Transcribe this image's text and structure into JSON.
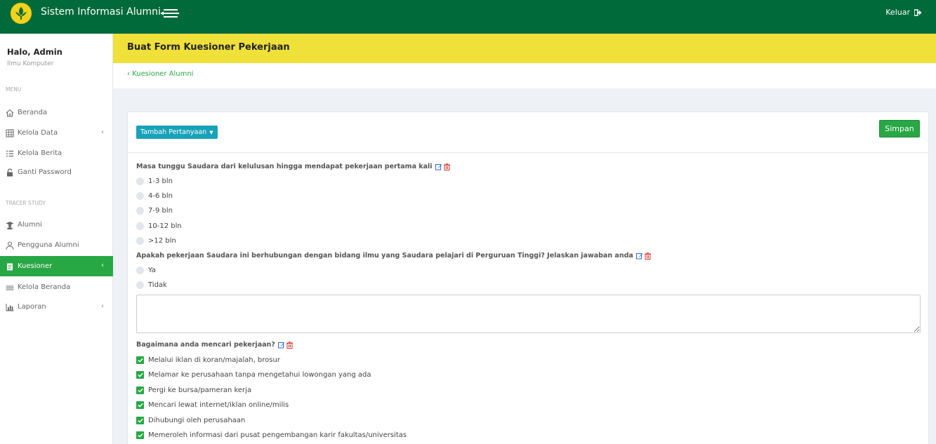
{
  "app": {
    "title": "Sistem Informasi Alumni",
    "logout_label": "Keluar"
  },
  "sidebar": {
    "greeting": "Halo, Admin",
    "department": "Ilmu Komputer",
    "menu_label": "MENU",
    "tracer_label": "TRACER STUDY",
    "items": [
      {
        "label": "Beranda",
        "icon": "home-icon"
      },
      {
        "label": "Kelola Data",
        "icon": "table-icon"
      },
      {
        "label": "Kelola Berita",
        "icon": "list-icon"
      },
      {
        "label": "Ganti Password",
        "icon": "lock-icon"
      },
      {
        "label": "Alumni",
        "icon": "graduate-icon"
      },
      {
        "label": "Pengguna Alumni",
        "icon": "user-icon"
      },
      {
        "label": "Kuesioner",
        "icon": "clipboard-icon",
        "active": true
      },
      {
        "label": "Kelola Beranda",
        "icon": "menu-lines-icon"
      },
      {
        "label": "Laporan",
        "icon": "bar-chart-icon"
      }
    ]
  },
  "page": {
    "title": "Buat Form Kuesioner Pekerjaan",
    "breadcrumb": "Kuesioner Alumni",
    "add_question_label": "Tambah Pertanyaan",
    "save_label": "Simpan"
  },
  "questions": [
    {
      "text": "Masa tunggu Saudara dari kelulusan hingga mendapat pekerjaan pertama kali",
      "type": "radio",
      "options": [
        "1-3 bln",
        "4-6 bln",
        "7-9 bln",
        "10-12 bln",
        ">12 bln"
      ]
    },
    {
      "text": "Apakah pekerjaan Saudara ini berhubungan dengan bidang ilmu yang Saudara pelajari di Perguruan Tinggi? Jelaskan jawaban anda",
      "type": "radio+textarea",
      "options": [
        "Ya",
        "Tidak"
      ]
    },
    {
      "text": "Bagaimana anda mencari pekerjaan?",
      "type": "checkbox",
      "options": [
        "Melalui iklan di koran/majalah, brosur",
        "Melamar ke perusahaan tanpa mengetahui lowongan yang ada",
        "Pergi ke bursa/pameran kerja",
        "Mencari lewat internet/iklan online/milis",
        "Dihubungi oleh perusahaan",
        "Memeroleh informasi dari pusat pengembangan karir fakultas/universitas"
      ]
    }
  ],
  "colors": {
    "topbar": "#006a3a",
    "accent": "#28a745",
    "header": "#efe03a",
    "info": "#17a2b8"
  }
}
